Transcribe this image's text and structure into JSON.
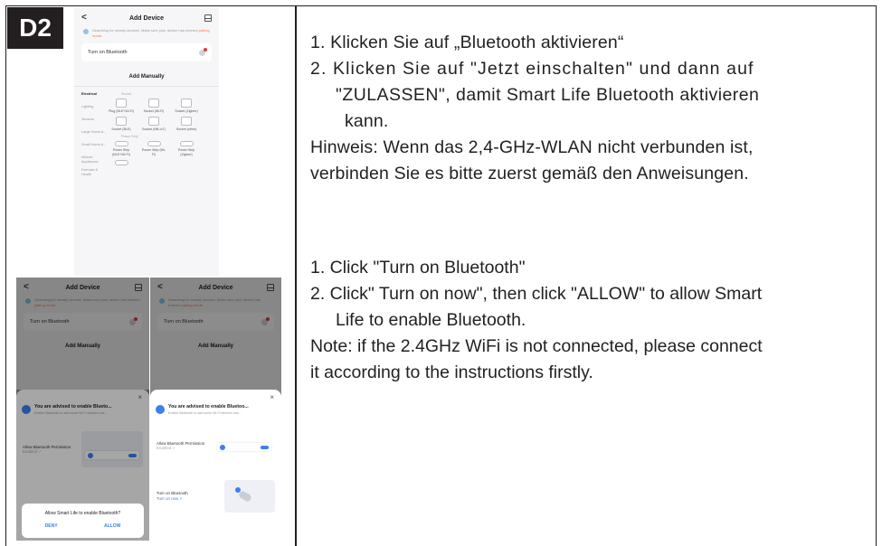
{
  "step_badge": "D2",
  "german": {
    "line1": "1. Klicken Sie auf „Bluetooth aktivieren“",
    "line2": "2. Klicken Sie auf \"Jetzt einschalten\" und dann auf",
    "line3": "\"ZULASSEN\", damit Smart Life Bluetooth aktivieren",
    "line4": "kann.",
    "line5": "Hinweis: Wenn das 2,4-GHz-WLAN nicht verbunden ist,",
    "line6": "verbinden Sie es bitte zuerst gemäß den Anweisungen."
  },
  "english": {
    "line1": "1. Click \"Turn on Bluetooth\"",
    "line2": "2. Click\" Turn on now\", then click \"ALLOW\" to allow Smart",
    "line3": "Life to enable Bluetooth.",
    "line4": "Note: if the 2.4GHz WiFi is not connected, please connect",
    "line5": "it according to the instructions firstly."
  },
  "phone": {
    "back": "<",
    "title": "Add Device",
    "searching_prefix": "Searching for nearby devices. Make sure your device has entered ",
    "searching_link": "pairing mode",
    "searching_suffix": ".",
    "bt_card": "Turn on Bluetooth",
    "add_manually": "Add Manually",
    "categories": [
      "Electrical",
      "Lighting",
      "Sensors",
      "Large Home A...",
      "Small Home A...",
      "Kitchen Appliances",
      "Exercise & Health"
    ],
    "socket_header": "Socket",
    "socket_items": [
      "Plug (BLE+Wi-Fi)",
      "Socket (Wi-Fi)",
      "Socket (Zigbee)",
      "Socket (BLE)",
      "Socket (NB-IoT)",
      "Socket (other)"
    ],
    "strip_header": "Power Strip",
    "strip_items": [
      "Power Strip (BLE+Wi-Fi)",
      "Power Strip (Wi-Fi)",
      "Power Strip (Zigbee)"
    ],
    "close": "×",
    "advise_title": "You are advised to enable Blueto...",
    "advise_title_full": "You are advised to enable Bluetoo...",
    "advise_sub": "Enable Bluetooth to add some Wi-Fi devices eas...",
    "permission_label": "Allow Bluetooth Permission",
    "permission_state": "Enabled ✓",
    "turn_on_label": "Turn on Bluetooth",
    "turn_on_link": "Turn on now >",
    "dialog_question": "Allow Smart Life to enable Bluetooth?",
    "deny": "DENY",
    "allow": "ALLOW"
  }
}
